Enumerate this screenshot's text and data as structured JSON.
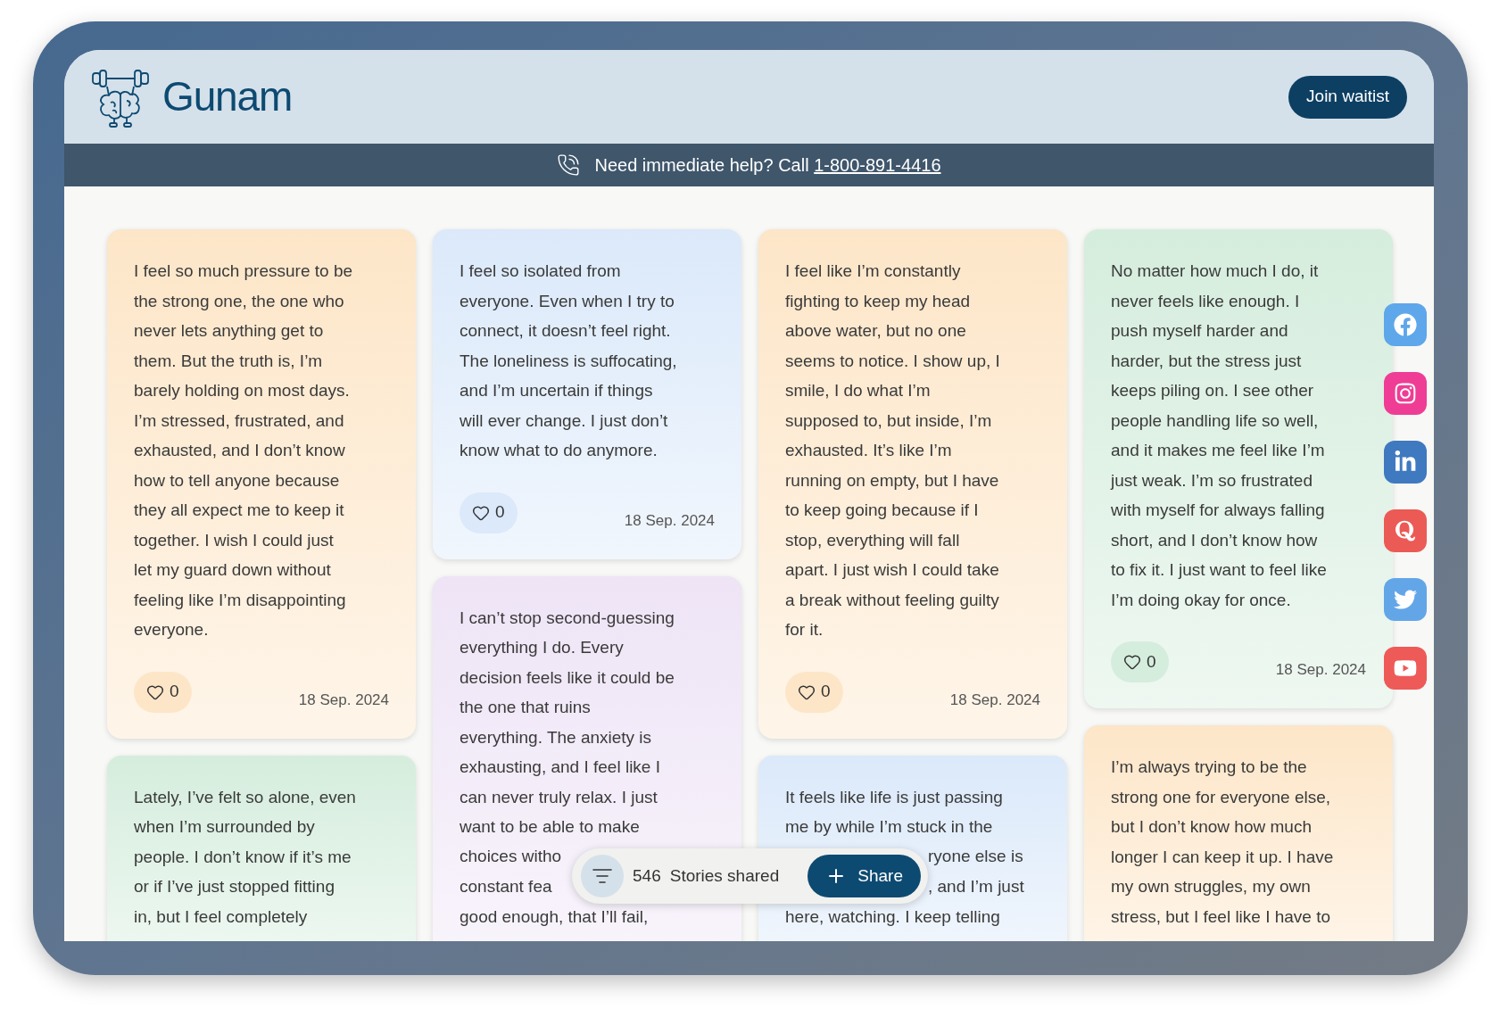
{
  "header": {
    "brand": "Gunam",
    "cta": "Join waitist"
  },
  "banner": {
    "text": "Need immediate help? Call",
    "phone": "1-800-891-4416"
  },
  "columns": [
    {
      "cards": [
        {
          "color": "#fde6c8",
          "lines": [
            "I feel so much pressure to be",
            "the strong one, the one who",
            "never lets anything get to",
            "them. But the truth is, I’m",
            "barely holding on most days.",
            "I’m stressed, frustrated, and",
            "exhausted, and I don’t know",
            "how to tell anyone because",
            "they all expect me to keep it",
            "together. I wish I could just",
            "let my guard down without",
            "feeling like I’m disappointing",
            "everyone."
          ],
          "likes": "0",
          "date": "18 Sep. 2024"
        },
        {
          "color": "#d5eddd",
          "lines": [
            "Lately, I’ve felt so alone, even",
            "when I’m surrounded by",
            "people. I don’t know if it’s me",
            "or if I’ve just stopped fitting",
            "in, but I feel completely"
          ]
        }
      ]
    },
    {
      "cards": [
        {
          "color": "#dbe9fa",
          "lines": [
            "I feel so isolated from",
            "everyone. Even when I try to",
            "connect, it doesn’t feel right.",
            "The loneliness is suffocating,",
            "and I’m uncertain if things",
            "will ever change. I just don’t",
            "know what to do anymore."
          ],
          "likes": "0",
          "date": "18 Sep. 2024"
        },
        {
          "color": "#eee4f6",
          "lines": [
            "I can’t stop second-guessing",
            "everything I do. Every",
            "decision feels like it could be",
            "the one that ruins",
            "everything. The anxiety is",
            "exhausting, and I feel like I",
            "can never truly relax. I just",
            "want to be able to make",
            {
              "text": "choices witho",
              "cut_start": false
            },
            {
              "text": "constant fea",
              "cut_start": false
            },
            "good enough, that I’ll fail,"
          ]
        }
      ]
    },
    {
      "cards": [
        {
          "color": "#fde6c8",
          "lines": [
            "I feel like I’m constantly",
            "fighting to keep my head",
            "above water, but no one",
            "seems to notice. I show up, I",
            "smile, I do what I’m",
            "supposed to, but inside, I’m",
            "exhausted. It’s like I’m",
            "running on empty, but I have",
            "to keep going because if I",
            "stop, everything will fall",
            "apart. I just wish I could take",
            "a break without feeling guilty",
            "for it."
          ],
          "likes": "0",
          "date": "18 Sep. 2024"
        },
        {
          "color": "#dbe9fa",
          "lines": [
            "It feels like life is just passing",
            "me by while I’m stuck in the",
            {
              "text": "ryone else is",
              "cut_start": true
            },
            {
              "text": ", and I’m just",
              "cut_start": true
            },
            "here, watching. I keep telling"
          ]
        }
      ]
    },
    {
      "cards": [
        {
          "color": "#d5eddd",
          "lines": [
            "No matter how much I do, it",
            "never feels like enough. I",
            "push myself harder and",
            "harder, but the stress just",
            "keeps piling on. I see other",
            "people handling life so well,",
            "and it makes me feel like I’m",
            "just weak. I’m so frustrated",
            "with myself for always falling",
            "short, and I don’t know how",
            "to fix it. I just want to feel like",
            "I’m doing okay for once."
          ],
          "likes": "0",
          "date": "18 Sep. 2024"
        },
        {
          "color": "#fde6c8",
          "lines": [
            "I’m always trying to be the",
            "strong one for everyone else,",
            "but I don’t know how much",
            "longer I can keep it up. I have",
            "my own struggles, my own",
            "stress, but I feel like I have to"
          ]
        }
      ]
    }
  ],
  "toolbar": {
    "count": "546",
    "label": "Stories shared",
    "share": "Share"
  }
}
